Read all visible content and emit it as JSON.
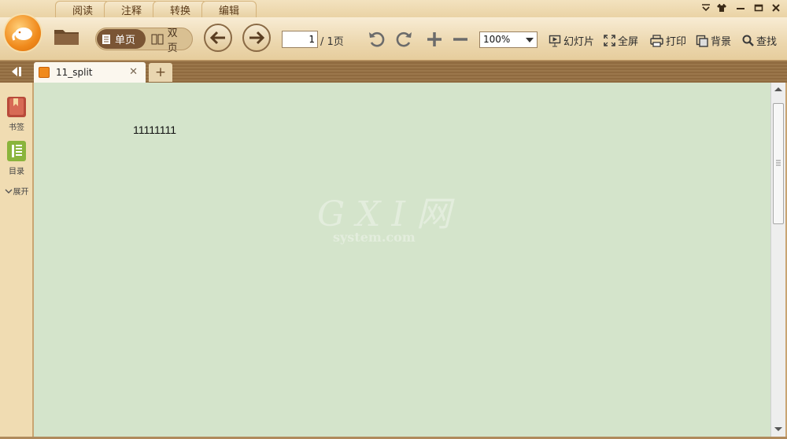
{
  "menu_tabs": [
    "阅读",
    "注释",
    "转换",
    "编辑"
  ],
  "window_controls": [
    "menu-icon",
    "skin-icon",
    "minimize-icon",
    "maximize-icon",
    "close-icon"
  ],
  "toolbar": {
    "view_single": "单页",
    "view_double": "双页",
    "page_current": "1",
    "page_total": "/ 1页",
    "zoom_value": "100%",
    "slideshow_label": "幻灯片",
    "fullscreen_label": "全屏",
    "print_label": "打印",
    "background_label": "背景",
    "find_label": "查找"
  },
  "tabs": [
    {
      "label": "11_split"
    }
  ],
  "sidebar": {
    "bookmark_label": "书签",
    "toc_label": "目录",
    "expand_label": "展开"
  },
  "document": {
    "text": "11111111"
  },
  "watermark": {
    "brand": "G X I 网",
    "domain": "system.com"
  },
  "colors": {
    "accent_orange": "#f08a1c",
    "content_bg": "#d4e4cb",
    "toolbar_bg": "#ecd7ae"
  }
}
